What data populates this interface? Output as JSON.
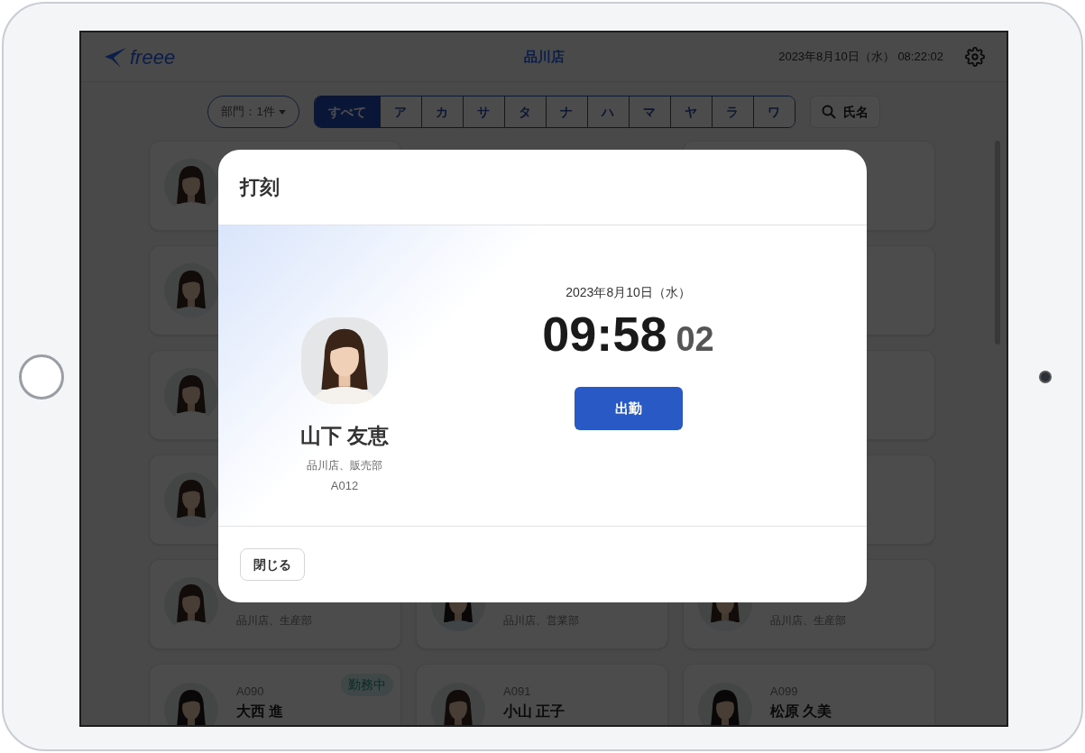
{
  "header": {
    "logo": "freee",
    "title": "品川店",
    "datetime": "2023年8月10日（水） 08:22:02"
  },
  "filters": {
    "department": "部門：1件",
    "kana_tabs": [
      {
        "label": "すべて",
        "selected": true
      },
      {
        "label": "ア",
        "selected": false
      },
      {
        "label": "カ",
        "selected": false
      },
      {
        "label": "サ",
        "selected": false
      },
      {
        "label": "タ",
        "selected": false
      },
      {
        "label": "ナ",
        "selected": false
      },
      {
        "label": "ハ",
        "selected": false
      },
      {
        "label": "マ",
        "selected": false
      },
      {
        "label": "ヤ",
        "selected": false
      },
      {
        "label": "ラ",
        "selected": false
      },
      {
        "label": "ワ",
        "selected": false
      }
    ],
    "search": "氏名"
  },
  "employee_cards": [
    {
      "kind": "avatar_only"
    },
    {
      "kind": "covered"
    },
    {
      "kind": "avatar_only"
    },
    {
      "kind": "covered"
    },
    {
      "kind": "avatar_only"
    },
    {
      "kind": "covered"
    },
    {
      "kind": "avatar_only"
    },
    {
      "kind": "covered"
    },
    {
      "kind": "dept_only",
      "dept": "品川店、生産部"
    },
    {
      "kind": "dept_only",
      "dept": "品川店、営業部"
    },
    {
      "kind": "dept_only",
      "dept": "品川店、生産部"
    },
    {
      "kind": "full",
      "id": "A090",
      "name": "大西 進",
      "badge": "勤務中"
    },
    {
      "kind": "full",
      "id": "A091",
      "name": "小山 正子"
    },
    {
      "kind": "full",
      "id": "A099",
      "name": "松原 久美"
    }
  ],
  "dialog": {
    "title": "打刻",
    "employee": {
      "name": "山下 友恵",
      "dept": "品川店、販売部",
      "id": "A012"
    },
    "date": "2023年8月10日（水）",
    "time": "09:58",
    "seconds": "02",
    "action_button": "出勤",
    "close_button": "閉じる"
  }
}
